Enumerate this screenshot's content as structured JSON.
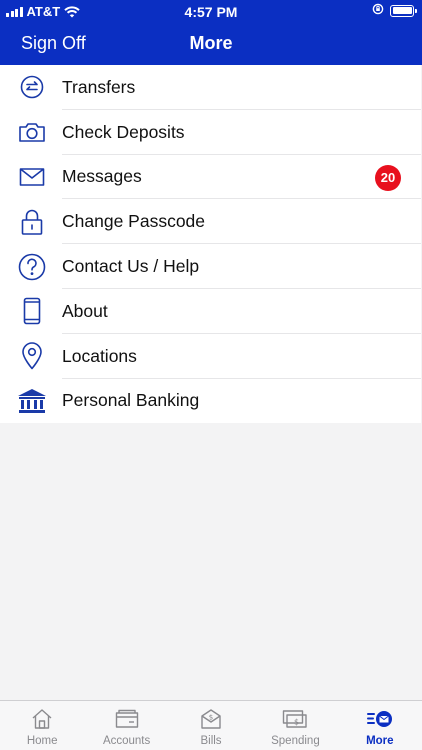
{
  "status_bar": {
    "carrier": "AT&T",
    "time": "4:57 PM"
  },
  "header": {
    "sign_off_label": "Sign Off",
    "title": "More"
  },
  "menu": {
    "items": [
      {
        "label": "Transfers",
        "icon": "transfer-arrows-icon"
      },
      {
        "label": "Check Deposits",
        "icon": "camera-icon"
      },
      {
        "label": "Messages",
        "icon": "envelope-icon",
        "badge": "20"
      },
      {
        "label": "Change Passcode",
        "icon": "lock-icon"
      },
      {
        "label": "Contact Us / Help",
        "icon": "question-circle-icon"
      },
      {
        "label": "About",
        "icon": "phone-device-icon"
      },
      {
        "label": "Locations",
        "icon": "map-pin-icon"
      },
      {
        "label": "Personal Banking",
        "icon": "bank-building-icon"
      }
    ]
  },
  "tab_bar": {
    "tabs": [
      {
        "label": "Home",
        "icon": "house-icon"
      },
      {
        "label": "Accounts",
        "icon": "wallet-icon"
      },
      {
        "label": "Bills",
        "icon": "envelope-dollar-icon"
      },
      {
        "label": "Spending",
        "icon": "money-bill-icon"
      },
      {
        "label": "More",
        "icon": "more-mail-icon",
        "active": true
      }
    ]
  },
  "colors": {
    "brand_blue": "#0b2fc2",
    "badge_red": "#e8101e",
    "icon_blue": "#1a3aa8"
  }
}
